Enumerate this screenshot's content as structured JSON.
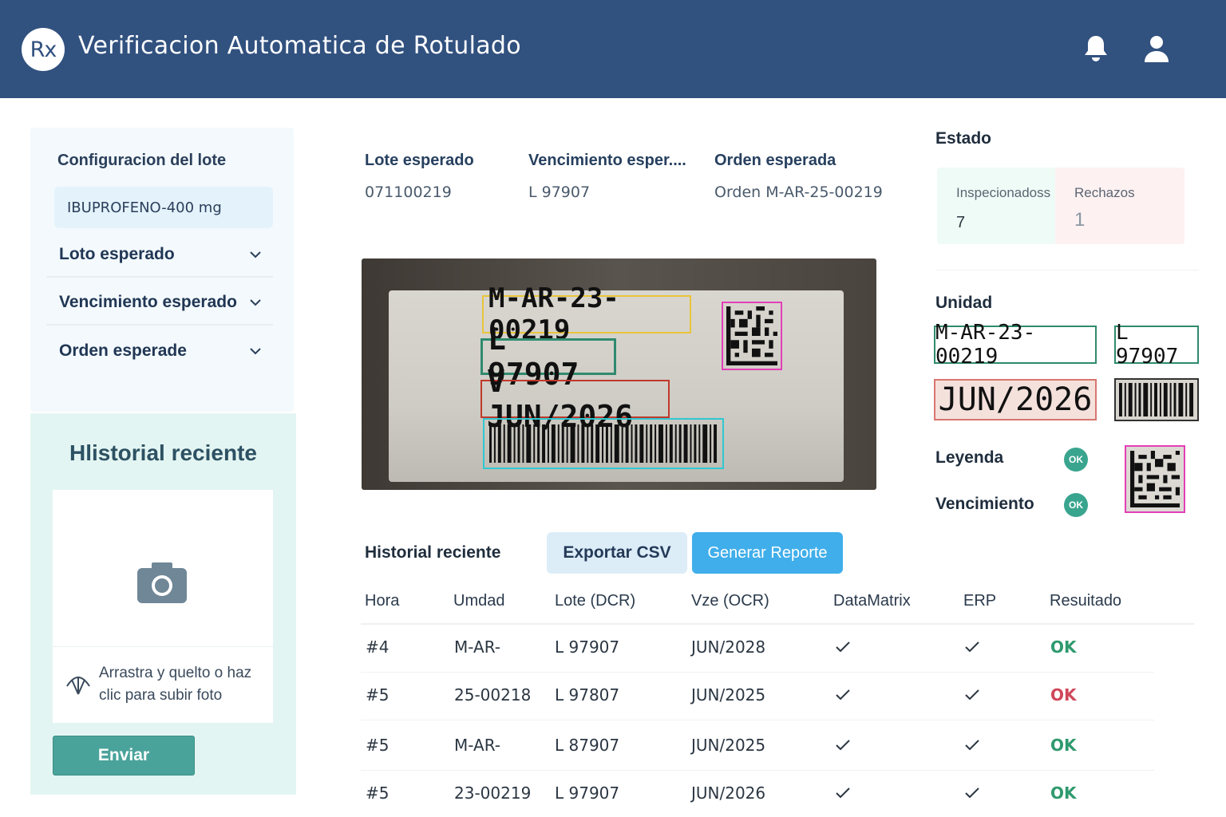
{
  "header": {
    "logo": "Rx",
    "title": "Verificacion Automatica de Rotulado",
    "icons": [
      "bell-icon",
      "user-icon"
    ],
    "background_color": "#31517f"
  },
  "config": {
    "title": "Configuracion del lote",
    "product": "IBUPROFENO-400 mg",
    "dropdowns": [
      {
        "label": "Loto esperado"
      },
      {
        "label": "Vencimiento esperado"
      },
      {
        "label": "Orden esperade"
      }
    ]
  },
  "left_history": {
    "title": "Hlistorial reciente",
    "upload_text": "Arrastra y quelto o haz clic para subir foto",
    "send_button": "Enviar"
  },
  "expected": [
    {
      "label": "Lote esperado",
      "value": "071100219"
    },
    {
      "label": "Vencimiento esper....",
      "value": "L 97907"
    },
    {
      "label": "Orden esperada",
      "value": "Orden M-AR-25-00219"
    }
  ],
  "photo": {
    "order": "M-AR-23-00219",
    "lot": "L 97907",
    "expiry": "V JUN/2026"
  },
  "estado": {
    "title": "Estado",
    "inspected_label": "Inspecionadoss",
    "inspected_value": "7",
    "rejected_label": "Rechazos",
    "rejected_value": "1"
  },
  "unidad": {
    "title": "Unidad",
    "order": "M-AR-23-00219",
    "lot": "L 97907",
    "expiry": "JUN/2026",
    "checks": [
      {
        "label": "Leyenda",
        "status": "OK"
      },
      {
        "label": "Vencimiento",
        "status": "OK"
      }
    ]
  },
  "history": {
    "title": "Historial reciente",
    "export_button": "Exportar CSV",
    "report_button": "Generar Reporte",
    "columns": [
      "Hora",
      "Umdad",
      "Lote (DCR)",
      "Vze (OCR)",
      "DataMatrix",
      "ERP",
      "Resuitado"
    ],
    "rows": [
      {
        "hora": "#4",
        "unidad": "M-AR-",
        "lote": "L 97907",
        "vze": "JUN/2028",
        "datamatrix": "check",
        "erp": "check",
        "resultado": "OK",
        "result_color": "#2f9a6e"
      },
      {
        "hora": "#5",
        "unidad": "25-00218",
        "lote": "L 97807",
        "vze": "JUN/2025",
        "datamatrix": "check",
        "erp": "check",
        "resultado": "OK",
        "result_color": "#d0475a"
      },
      {
        "hora": "#5",
        "unidad": "M-AR-",
        "lote": "L 87907",
        "vze": "JUN/2025",
        "datamatrix": "check",
        "erp": "check",
        "resultado": "OK",
        "result_color": "#2f9a6e"
      },
      {
        "hora": "#5",
        "unidad": "23-00219",
        "lote": "L 97907",
        "vze": "JUN/2026",
        "datamatrix": "check",
        "erp": "check",
        "resultado": "OK",
        "result_color": "#2f9a6e"
      }
    ]
  }
}
